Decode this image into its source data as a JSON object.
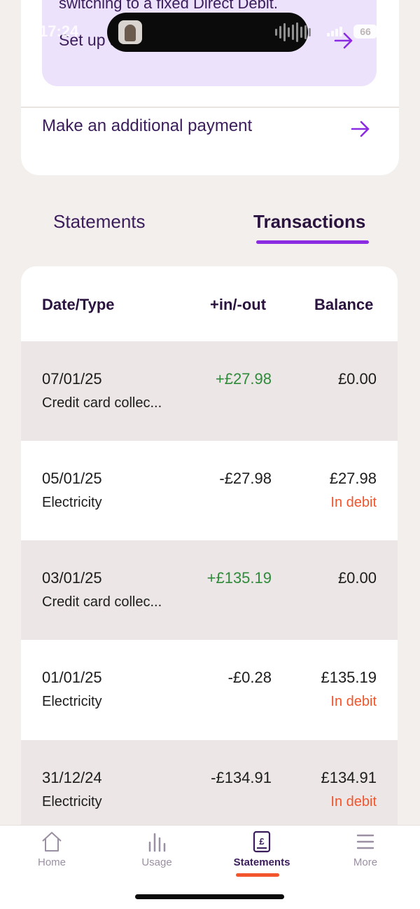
{
  "top_card": {
    "direct_debit_promo_text": "switching to a fixed Direct Debit.",
    "direct_debit_link_label": "Set up a Direct Debit",
    "additional_payment_label": "Make an additional payment"
  },
  "status_bar": {
    "time": "17:24",
    "battery": "66"
  },
  "tabs": [
    {
      "label": "Statements",
      "active": false
    },
    {
      "label": "Transactions",
      "active": true
    }
  ],
  "table": {
    "headers": {
      "date_type": "Date/Type",
      "in_out": "+in/-out",
      "balance": "Balance"
    },
    "rows": [
      {
        "date": "07/01/25",
        "type": "Credit card collec...",
        "amount": "+£27.98",
        "kind": "credit",
        "balance": "£0.00",
        "status": ""
      },
      {
        "date": "05/01/25",
        "type": "Electricity",
        "amount": "-£27.98",
        "kind": "debit",
        "balance": "£27.98",
        "status": "In debit"
      },
      {
        "date": "03/01/25",
        "type": "Credit card collec...",
        "amount": "+£135.19",
        "kind": "credit",
        "balance": "£0.00",
        "status": ""
      },
      {
        "date": "01/01/25",
        "type": "Electricity",
        "amount": "-£0.28",
        "kind": "debit",
        "balance": "£135.19",
        "status": "In debit"
      },
      {
        "date": "31/12/24",
        "type": "Electricity",
        "amount": "-£134.91",
        "kind": "debit",
        "balance": "£134.91",
        "status": "In debit"
      }
    ]
  },
  "bottom_nav": [
    {
      "label": "Home",
      "icon": "home-icon",
      "active": false
    },
    {
      "label": "Usage",
      "icon": "bar-chart-icon",
      "active": false
    },
    {
      "label": "Statements",
      "icon": "receipt-icon",
      "active": true
    },
    {
      "label": "More",
      "icon": "menu-icon",
      "active": false
    }
  ],
  "colors": {
    "brand_purple": "#8b2be2",
    "text_purple": "#3b1d5c",
    "credit_green": "#2e8b3a",
    "debit_orange": "#f2552c",
    "page_bg": "#f3efec",
    "promo_bg": "#ece2fb"
  }
}
